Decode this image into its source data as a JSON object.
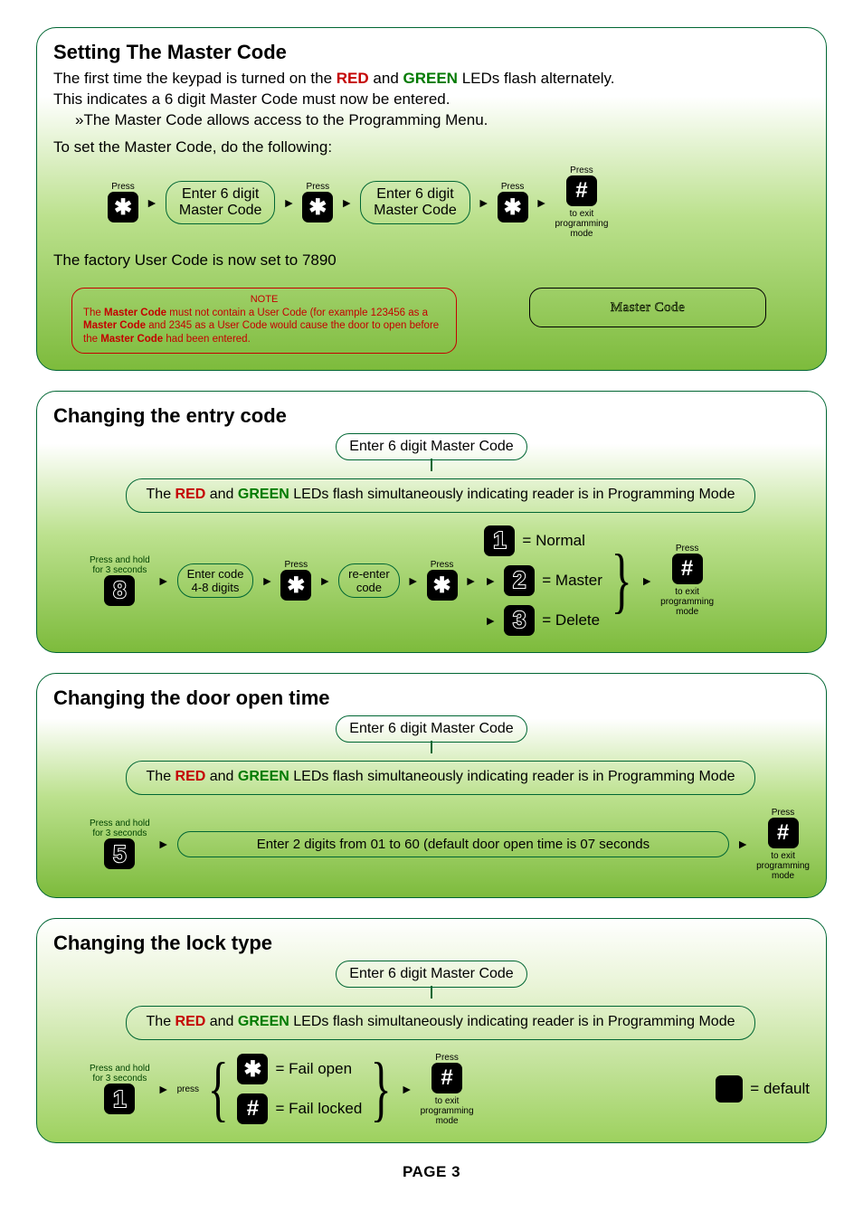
{
  "page_label": "PAGE 3",
  "section1": {
    "title": "Setting The Master Code",
    "line1_pre": "The first time the keypad is turned on the ",
    "line1_red": "RED",
    "line1_mid": " and ",
    "line1_green": "GREEN",
    "line1_post": " LEDs flash alternately.",
    "line2": "This indicates a 6 digit Master Code must now be entered.",
    "line3": "»The Master Code allows access to the Programming Menu.",
    "line4": "To set the Master Code, do the following:",
    "press": "Press",
    "enter6": "Enter 6 digit\nMaster Code",
    "exit1": "to exit",
    "exit2": "programming",
    "exit3": "mode",
    "factory": "The factory User Code is now set to 7890",
    "note_title": "NOTE",
    "note_body_a": "The ",
    "note_body_b": "Master Code",
    "note_body_c": " must not contain a User Code (for example 123456 as a ",
    "note_body_d": "Master Code",
    "note_body_e": " and 2345 as a User Code would cause the door to open before the ",
    "note_body_f": "Master Code",
    "note_body_g": " had been entered.",
    "master_label": "Master Code"
  },
  "section2": {
    "title": "Changing the entry code",
    "enter_master": "Enter 6 digit Master Code",
    "status_a": "The ",
    "status_red": "RED",
    "status_b": " and ",
    "status_green": "GREEN",
    "status_c": " LEDs flash simultaneously indicating reader is in Programming Mode",
    "hold": "Press and hold\nfor 3 seconds",
    "press": "Press",
    "enter_code": "Enter code\n4-8 digits",
    "reenter": "re-enter\ncode",
    "opt1": "= Normal",
    "opt2": "= Master",
    "opt3": "= Delete",
    "exit1": "to exit",
    "exit2": "programming",
    "exit3": "mode"
  },
  "section3": {
    "title": "Changing the door open time",
    "enter_master": "Enter 6 digit Master Code",
    "status_a": "The ",
    "status_red": "RED",
    "status_b": " and ",
    "status_green": "GREEN",
    "status_c": " LEDs flash simultaneously indicating reader is in Programming Mode",
    "hold": "Press and hold\nfor 3 seconds",
    "press": "Press",
    "instr": "Enter 2 digits from 01 to 60 (default door open time is 07 seconds",
    "exit1": "to exit",
    "exit2": "programming",
    "exit3": "mode"
  },
  "section4": {
    "title": "Changing the lock type",
    "enter_master": "Enter 6 digit Master Code",
    "status_a": "The ",
    "status_red": "RED",
    "status_b": " and ",
    "status_green": "GREEN",
    "status_c": " LEDs flash simultaneously indicating reader is in Programming Mode",
    "hold": "Press and hold\nfor 3 seconds",
    "press": "Press",
    "press_lc": "press",
    "fail_open": "= Fail open",
    "fail_locked": "= Fail locked",
    "default": "= default",
    "exit1": "to exit",
    "exit2": "programming",
    "exit3": "mode"
  }
}
